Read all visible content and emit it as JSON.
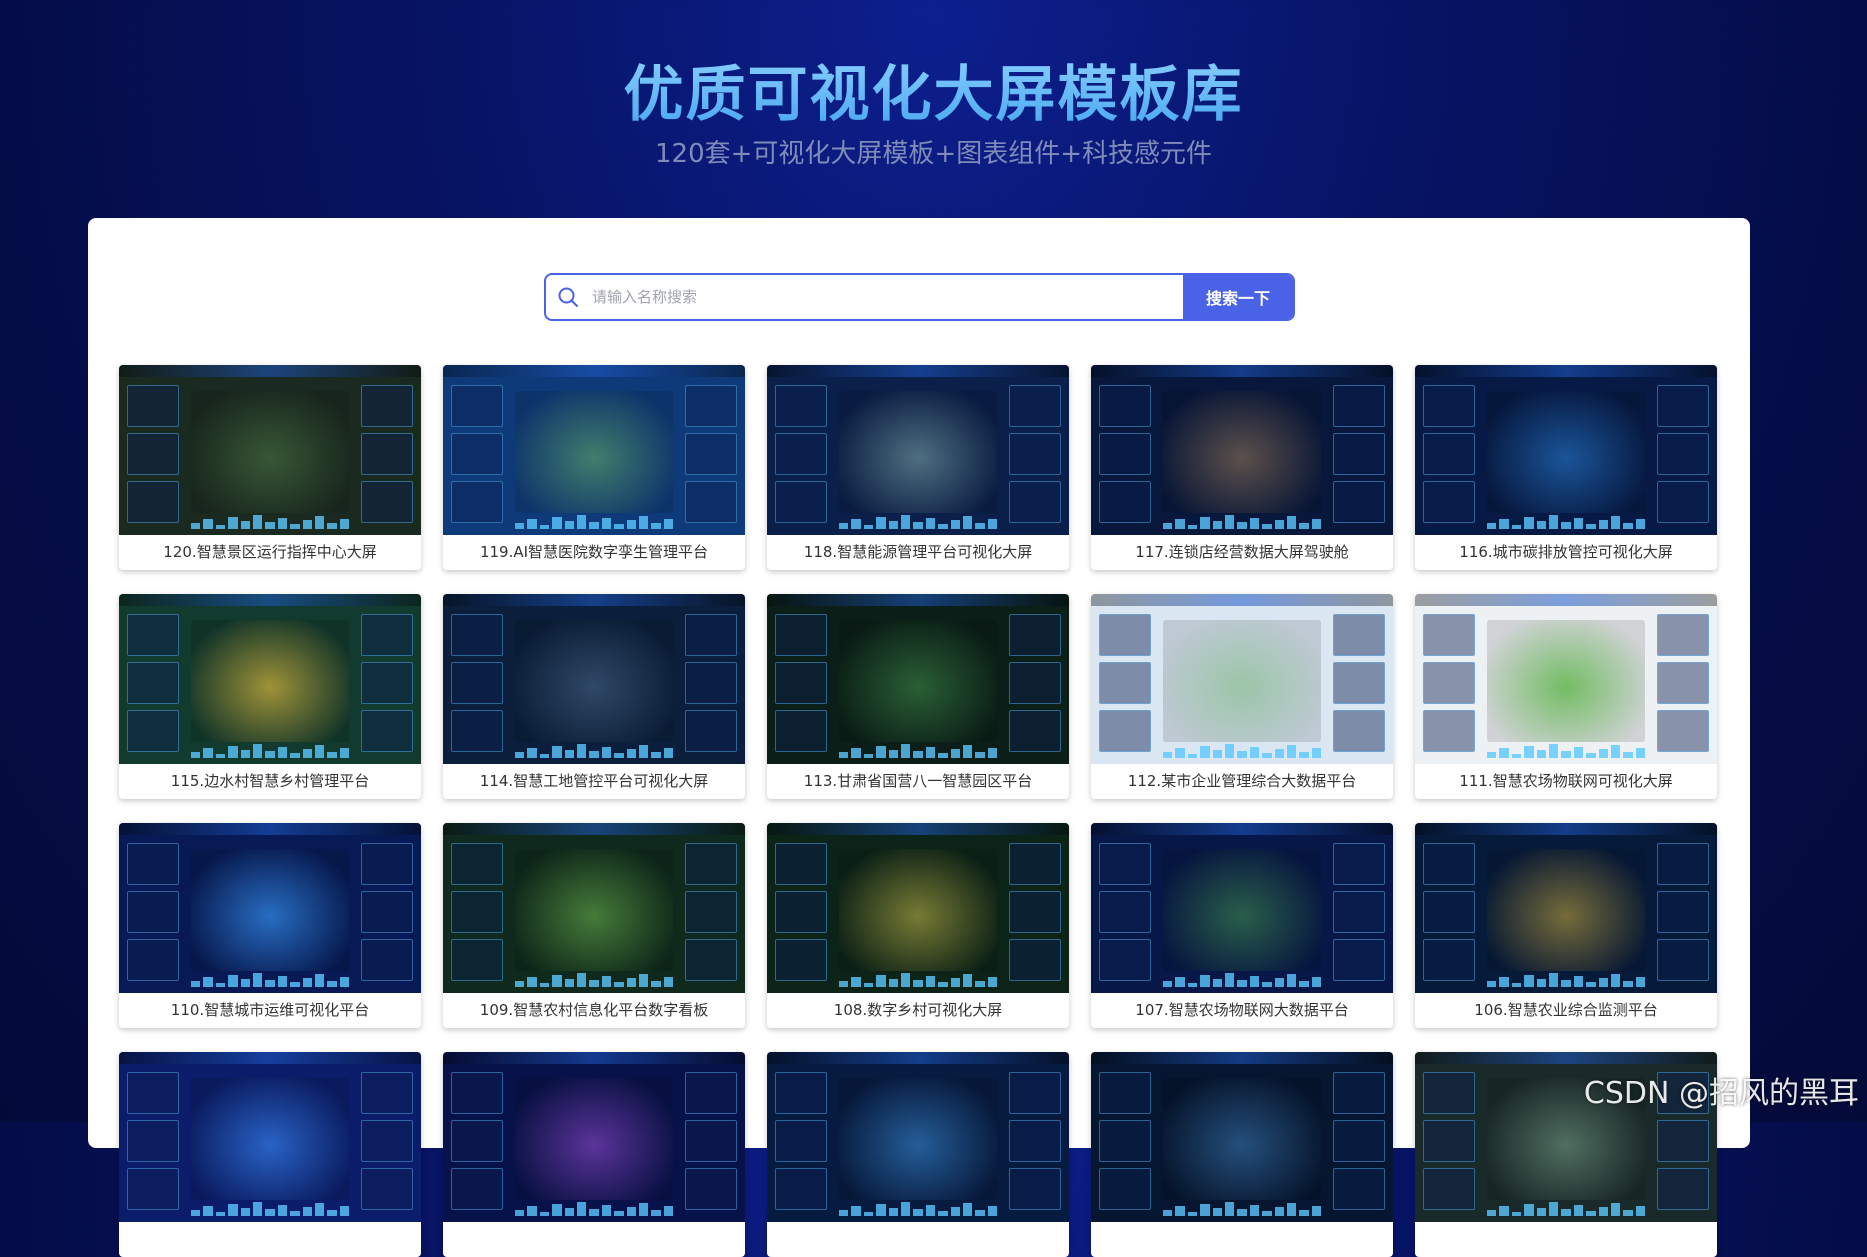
{
  "header": {
    "title": "优质可视化大屏模板库",
    "subtitle": "120套+可视化大屏模板+图表组件+科技感元件"
  },
  "search": {
    "placeholder": "请输入名称搜索",
    "button_label": "搜索一下",
    "icon": "search-icon"
  },
  "templates": [
    {
      "label": "120.智慧景区运行指挥中心大屏",
      "bg": "#1b2a20",
      "accent": "#3d5f3a"
    },
    {
      "label": "119.AI智慧医院数字孪生管理平台",
      "bg": "#0f3a7a",
      "accent": "#4a8a6a"
    },
    {
      "label": "118.智慧能源管理平台可视化大屏",
      "bg": "#0a1f4a",
      "accent": "#5a7d8a"
    },
    {
      "label": "117.连锁店经营数据大屏驾驶舱",
      "bg": "#08183d",
      "accent": "#6b5a4e"
    },
    {
      "label": "116.城市碳排放管控可视化大屏",
      "bg": "#071a45",
      "accent": "#1e5fa8"
    },
    {
      "label": "115.边水村智慧乡村管理平台",
      "bg": "#123a2e",
      "accent": "#b8a23a"
    },
    {
      "label": "114.智慧工地管控平台可视化大屏",
      "bg": "#0b1f3c",
      "accent": "#36506e"
    },
    {
      "label": "113.甘肃省国营八一智慧园区平台",
      "bg": "#0b1f18",
      "accent": "#2f6b3a"
    },
    {
      "label": "112.某市企业管理综合大数据平台",
      "bg": "#dbe6f3",
      "accent": "#8fc09a"
    },
    {
      "label": "111.智慧农场物联网可视化大屏",
      "bg": "#eef1f4",
      "accent": "#5db34a"
    },
    {
      "label": "110.智慧城市运维可视化平台",
      "bg": "#071a55",
      "accent": "#2e7cd6"
    },
    {
      "label": "109.智慧农村信息化平台数字看板",
      "bg": "#0f2a1c",
      "accent": "#4f8a3f"
    },
    {
      "label": "108.数字乡村可视化大屏",
      "bg": "#0c2418",
      "accent": "#8a8a3a"
    },
    {
      "label": "107.智慧农场物联网大数据平台",
      "bg": "#071848",
      "accent": "#2f6b4a"
    },
    {
      "label": "106.智慧农业综合监测平台",
      "bg": "#061a3a",
      "accent": "#8a7a3a"
    },
    {
      "label": "",
      "bg": "#0b1d6a",
      "accent": "#2e6fd6"
    },
    {
      "label": "",
      "bg": "#08124a",
      "accent": "#6a3aa8"
    },
    {
      "label": "",
      "bg": "#071a40",
      "accent": "#2a6aa8"
    },
    {
      "label": "",
      "bg": "#061630",
      "accent": "#2a5a8a"
    },
    {
      "label": "",
      "bg": "#1a2a2a",
      "accent": "#5a7a6a"
    }
  ],
  "watermark": "CSDN @招风的黑耳"
}
